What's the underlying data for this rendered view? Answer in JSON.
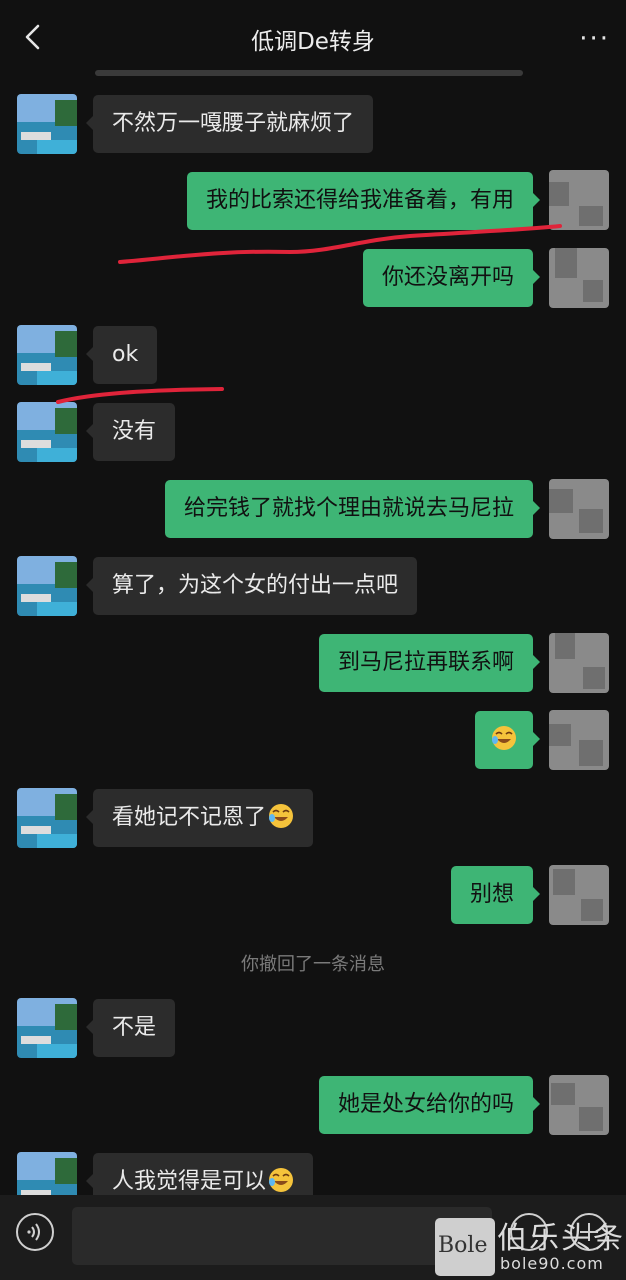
{
  "header": {
    "title": "低调De转身",
    "more_label": "···"
  },
  "messages": [
    {
      "side": "in",
      "text": "不然万一嘎腰子就麻烦了"
    },
    {
      "side": "out",
      "text": "我的比索还得给我准备着，有用"
    },
    {
      "side": "out",
      "text": "你还没离开吗"
    },
    {
      "side": "in",
      "text": "ok"
    },
    {
      "side": "in",
      "text": "没有"
    },
    {
      "side": "out",
      "text": "给完钱了就找个理由就说去马尼拉"
    },
    {
      "side": "in",
      "text": "算了，为这个女的付出一点吧"
    },
    {
      "side": "out",
      "text": "到马尼拉再联系啊"
    },
    {
      "side": "out",
      "text": "",
      "emoji": "rolling-laughing"
    },
    {
      "side": "in",
      "text": "看她记不记恩了",
      "emoji": "rolling-laughing"
    },
    {
      "side": "out",
      "text": "别想"
    },
    {
      "side": "in",
      "text": "不是"
    },
    {
      "side": "out",
      "text": "她是处女给你的吗"
    },
    {
      "side": "in",
      "text": "人我觉得是可以",
      "emoji": "rolling-laughing"
    }
  ],
  "system_notice": "你撤回了一条消息",
  "watermark": {
    "logo_text": "Bole",
    "cn_text": "伯乐头条",
    "url": "bole90.com"
  },
  "colors": {
    "background": "#111111",
    "incoming_bubble": "#2c2c2c",
    "outgoing_bubble": "#3eb575",
    "annotation_line": "#e0243a"
  }
}
